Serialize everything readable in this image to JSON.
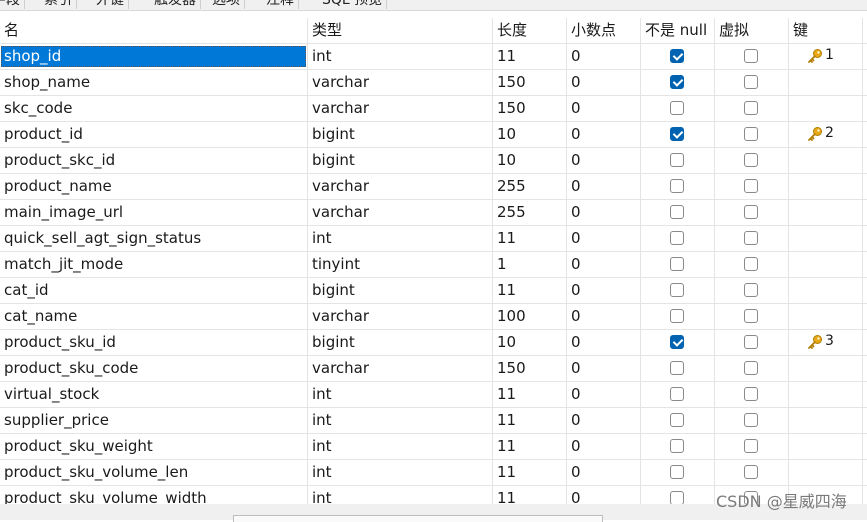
{
  "tabs": [
    "字段",
    "索引",
    "外键",
    "触发器",
    "选项",
    "注释",
    "SQL 预览"
  ],
  "columns": {
    "name": "名",
    "type": "类型",
    "length": "长度",
    "decimals": "小数点",
    "not_null": "不是 null",
    "virtual": "虚拟",
    "key": "键"
  },
  "rows": [
    {
      "name": "shop_id",
      "type": "int",
      "length": "11",
      "decimals": "0",
      "not_null": true,
      "virtual": false,
      "key": "1"
    },
    {
      "name": "shop_name",
      "type": "varchar",
      "length": "150",
      "decimals": "0",
      "not_null": true,
      "virtual": false,
      "key": ""
    },
    {
      "name": "skc_code",
      "type": "varchar",
      "length": "150",
      "decimals": "0",
      "not_null": false,
      "virtual": false,
      "key": ""
    },
    {
      "name": "product_id",
      "type": "bigint",
      "length": "10",
      "decimals": "0",
      "not_null": true,
      "virtual": false,
      "key": "2"
    },
    {
      "name": "product_skc_id",
      "type": "bigint",
      "length": "10",
      "decimals": "0",
      "not_null": false,
      "virtual": false,
      "key": ""
    },
    {
      "name": "product_name",
      "type": "varchar",
      "length": "255",
      "decimals": "0",
      "not_null": false,
      "virtual": false,
      "key": ""
    },
    {
      "name": "main_image_url",
      "type": "varchar",
      "length": "255",
      "decimals": "0",
      "not_null": false,
      "virtual": false,
      "key": ""
    },
    {
      "name": "quick_sell_agt_sign_status",
      "type": "int",
      "length": "11",
      "decimals": "0",
      "not_null": false,
      "virtual": false,
      "key": ""
    },
    {
      "name": "match_jit_mode",
      "type": "tinyint",
      "length": "1",
      "decimals": "0",
      "not_null": false,
      "virtual": false,
      "key": ""
    },
    {
      "name": "cat_id",
      "type": "bigint",
      "length": "11",
      "decimals": "0",
      "not_null": false,
      "virtual": false,
      "key": ""
    },
    {
      "name": "cat_name",
      "type": "varchar",
      "length": "100",
      "decimals": "0",
      "not_null": false,
      "virtual": false,
      "key": ""
    },
    {
      "name": "product_sku_id",
      "type": "bigint",
      "length": "10",
      "decimals": "0",
      "not_null": true,
      "virtual": false,
      "key": "3"
    },
    {
      "name": "product_sku_code",
      "type": "varchar",
      "length": "150",
      "decimals": "0",
      "not_null": false,
      "virtual": false,
      "key": ""
    },
    {
      "name": "virtual_stock",
      "type": "int",
      "length": "11",
      "decimals": "0",
      "not_null": false,
      "virtual": false,
      "key": ""
    },
    {
      "name": "supplier_price",
      "type": "int",
      "length": "11",
      "decimals": "0",
      "not_null": false,
      "virtual": false,
      "key": ""
    },
    {
      "name": "product_sku_weight",
      "type": "int",
      "length": "11",
      "decimals": "0",
      "not_null": false,
      "virtual": false,
      "key": ""
    },
    {
      "name": "product_sku_volume_len",
      "type": "int",
      "length": "11",
      "decimals": "0",
      "not_null": false,
      "virtual": false,
      "key": ""
    },
    {
      "name": "product_sku_volume_width",
      "type": "int",
      "length": "11",
      "decimals": "0",
      "not_null": false,
      "virtual": false,
      "key": ""
    }
  ],
  "selected_row": 0,
  "key_icon": "key-icon",
  "watermark": "CSDN @星威四海",
  "colors": {
    "selection": "#0078d7",
    "checkbox_checked": "#0063b1",
    "key": "#e8a917"
  }
}
